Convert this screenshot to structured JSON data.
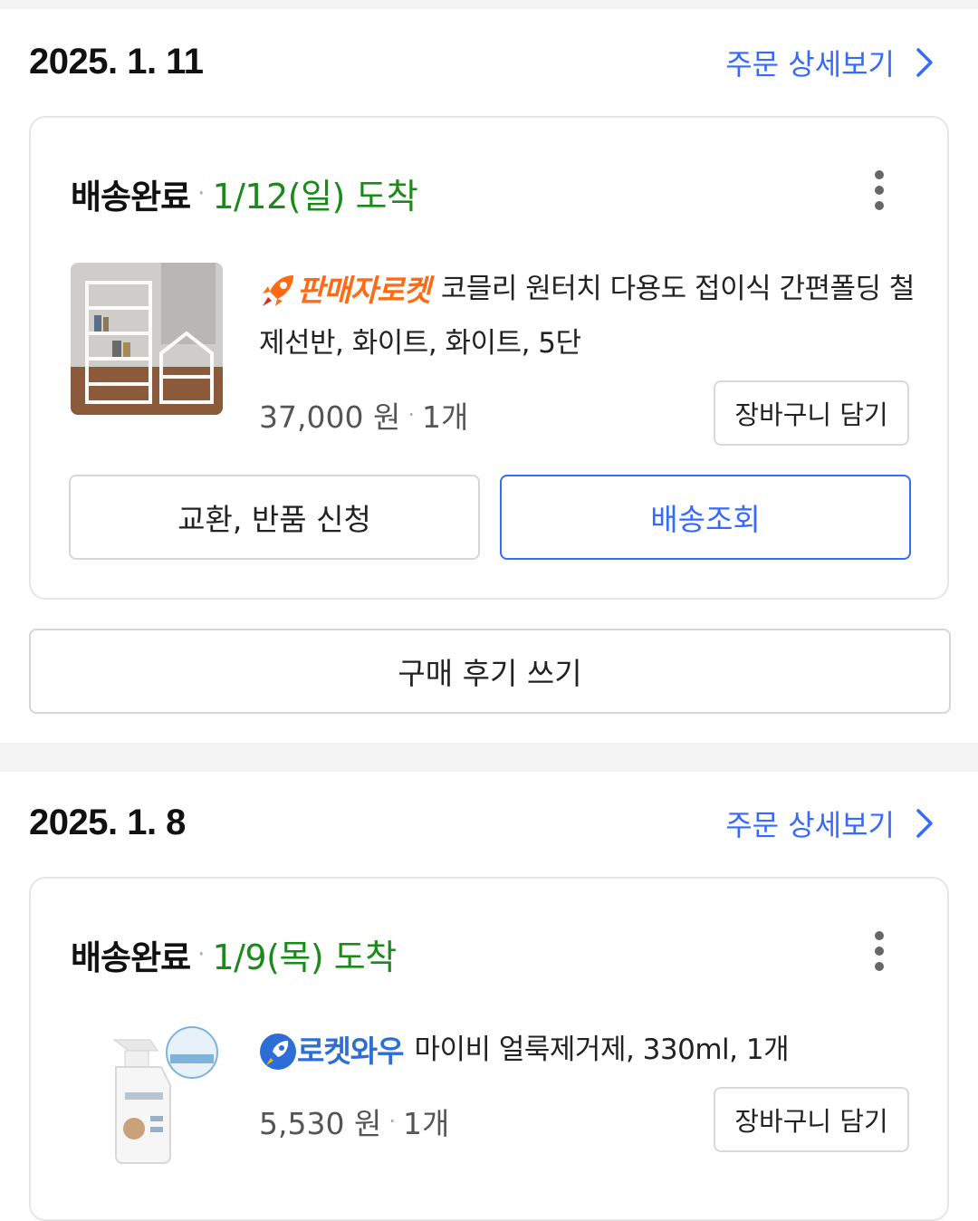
{
  "orders": [
    {
      "date": "2025. 1. 11",
      "detail_link": "주문 상세보기",
      "status": "배송완료",
      "arrival": "1/12(일) 도착",
      "badge": {
        "label": "판매자로켓",
        "icon": "rocket-icon",
        "color": "#ff6a13"
      },
      "product_title": "코믈리 원터치 다용도 접이식 간편폴딩 철제선반, 화이트, 화이트, 5단",
      "price": "37,000 원",
      "quantity": "1개",
      "cart_button": "장바구니 담기",
      "exchange_button": "교환, 반품 신청",
      "tracking_button": "배송조회",
      "review_button": "구매 후기 쓰기"
    },
    {
      "date": "2025. 1. 8",
      "detail_link": "주문 상세보기",
      "status": "배송완료",
      "arrival": "1/9(목) 도착",
      "badge": {
        "label": "로켓와우",
        "icon": "rocket-wow-icon",
        "color": "#2d6dd6"
      },
      "product_title": "마이비 얼룩제거제, 330ml, 1개",
      "price": "5,530 원",
      "quantity": "1개",
      "cart_button": "장바구니 담기"
    }
  ],
  "colors": {
    "accent": "#346aff",
    "delivered_date": "#1a8a1a",
    "rocket_orange": "#ff6a13"
  }
}
